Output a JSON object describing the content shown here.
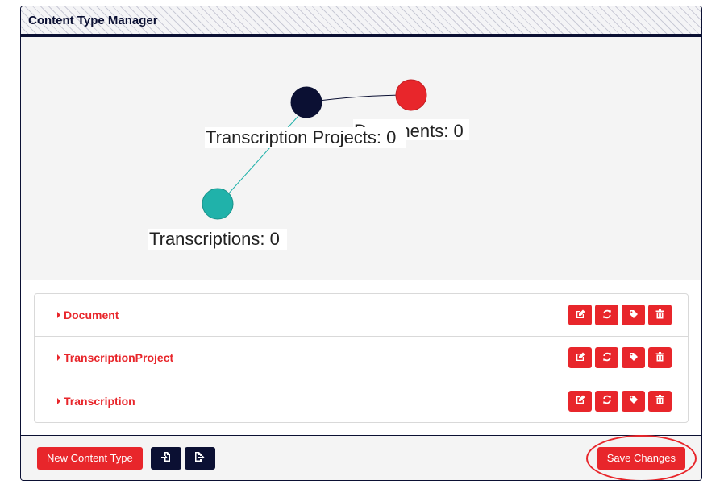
{
  "panel": {
    "title": "Content Type Manager"
  },
  "graph": {
    "nodes": [
      {
        "id": "transcription-projects",
        "label": "Transcription Projects: 0",
        "color": "#0b1033"
      },
      {
        "id": "documents",
        "label": "Documents: 0",
        "color": "#e8262b"
      },
      {
        "id": "transcriptions",
        "label": "Transcriptions: 0",
        "color": "#20b2aa"
      }
    ],
    "edges": [
      {
        "from": "transcription-projects",
        "to": "documents",
        "color": "#0b1033"
      },
      {
        "from": "transcription-projects",
        "to": "transcriptions",
        "color": "#20b2aa"
      }
    ]
  },
  "content_types": [
    {
      "label": "Document"
    },
    {
      "label": "TranscriptionProject"
    },
    {
      "label": "Transcription"
    }
  ],
  "row_actions": [
    {
      "name": "edit",
      "icon": "edit-icon"
    },
    {
      "name": "refresh",
      "icon": "refresh-icon"
    },
    {
      "name": "tag",
      "icon": "tag-icon"
    },
    {
      "name": "delete",
      "icon": "trash-icon"
    }
  ],
  "footer": {
    "new_label": "New Content Type",
    "import_icon": "file-import-icon",
    "export_icon": "file-export-icon",
    "save_label": "Save Changes"
  },
  "colors": {
    "accent": "#e8262b",
    "dark": "#0b1033",
    "teal": "#20b2aa"
  }
}
